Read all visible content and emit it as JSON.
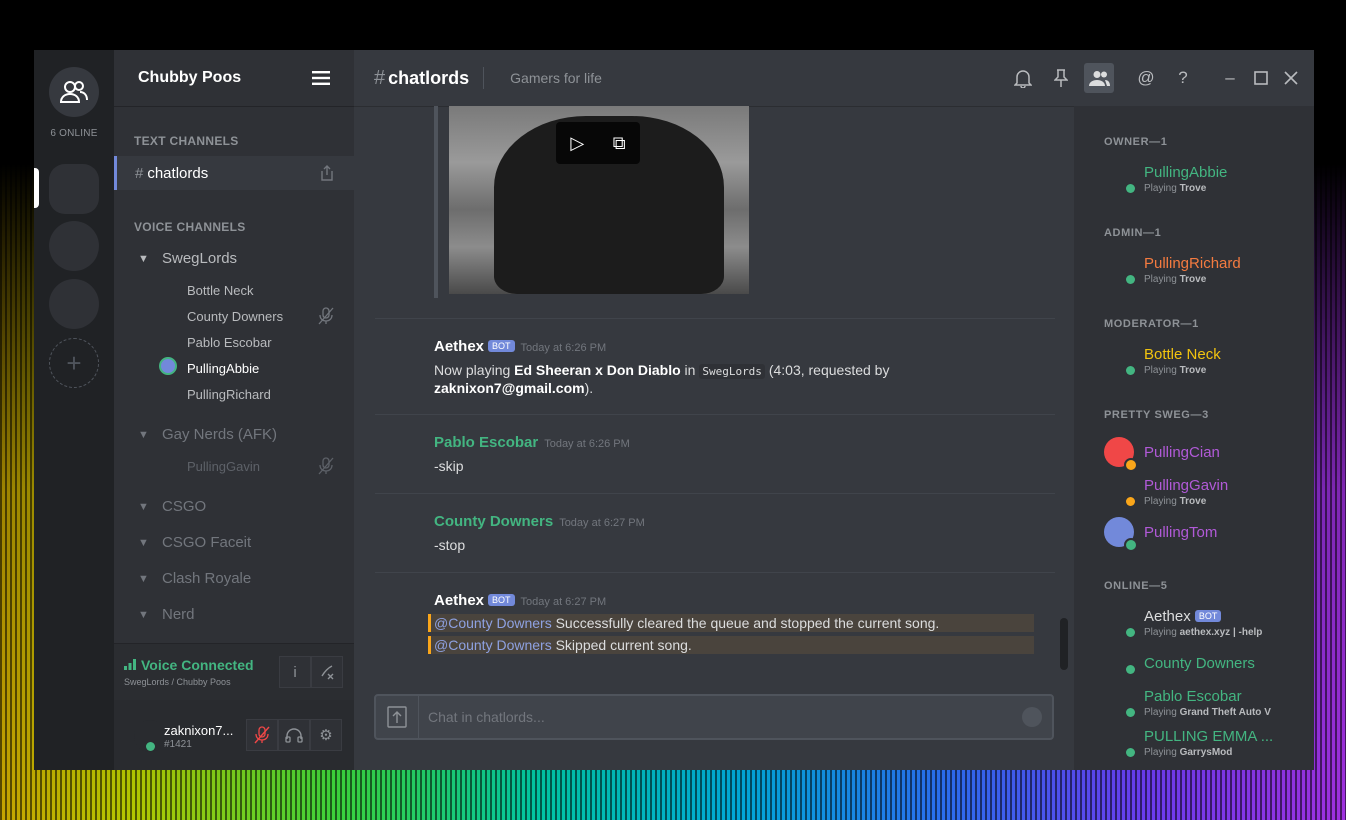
{
  "rail": {
    "online_count": "6 ONLINE"
  },
  "server": {
    "name": "Chubby Poos"
  },
  "sidebar": {
    "text_channels_label": "TEXT CHANNELS",
    "active_channel": "chatlords",
    "voice_channels_label": "VOICE CHANNELS",
    "voice_channels": [
      {
        "name": "SwegLords",
        "users": [
          "Bottle Neck",
          "County Downers",
          "Pablo Escobar",
          "PullingAbbie",
          "PullingRichard"
        ]
      },
      {
        "name": "Gay Nerds (AFK)",
        "users": [
          "PullingGavin"
        ]
      },
      {
        "name": "CSGO"
      },
      {
        "name": "CSGO Faceit"
      },
      {
        "name": "Clash Royale"
      },
      {
        "name": "Nerd"
      }
    ],
    "voice_status": "Voice Connected",
    "voice_sub": "SwegLords / Chubby Poos",
    "user": {
      "name": "zaknixon7...",
      "tag": "#1421"
    }
  },
  "header": {
    "hash": "#",
    "channel": "chatlords",
    "topic": "Gamers for life"
  },
  "messages": [
    {
      "author": "Aethex",
      "badge": "BOT",
      "time": "Today at 6:26 PM",
      "text_1": "Now playing ",
      "song": "Ed Sheeran x Don Diablo",
      "text_2": " in ",
      "channel": "SwegLords",
      "text_3": " (4:03, requested by ",
      "email": "zaknixon7@gmail.com",
      "text_4": ")."
    },
    {
      "author": "Pablo Escobar",
      "time": "Today at 6:26 PM",
      "text": "-skip"
    },
    {
      "author": "County Downers",
      "time": "Today at 6:27 PM",
      "text": "-stop"
    },
    {
      "author": "Aethex",
      "badge": "BOT",
      "time": "Today at 6:27 PM",
      "mention": "@County Downers",
      "line_1": " Successfully cleared the queue and stopped the current song.",
      "line_2": " Skipped current song."
    }
  ],
  "input": {
    "placeholder": "Chat in chatlords..."
  },
  "members": {
    "groups": [
      {
        "label": "OWNER—1",
        "members": [
          {
            "name": "PullingAbbie",
            "playing": "Playing ",
            "game": "Trove",
            "color": "#43b581"
          }
        ]
      },
      {
        "label": "ADMIN—1",
        "members": [
          {
            "name": "PullingRichard",
            "playing": "Playing ",
            "game": "Trove",
            "color": "#f47b40"
          }
        ]
      },
      {
        "label": "MODERATOR—1",
        "members": [
          {
            "name": "Bottle Neck",
            "playing": "Playing ",
            "game": "Trove",
            "color": "#f1c40f"
          }
        ]
      },
      {
        "label": "PRETTY SWEG—3",
        "members": [
          {
            "name": "PullingCian",
            "color": "#b15ad8"
          },
          {
            "name": "PullingGavin",
            "playing": "Playing ",
            "game": "Trove",
            "color": "#b15ad8"
          },
          {
            "name": "PullingTom",
            "color": "#b15ad8"
          }
        ]
      },
      {
        "label": "ONLINE—5",
        "members": [
          {
            "name": "Aethex",
            "badge": "BOT",
            "playing": "Playing ",
            "game": "aethex.xyz | -help",
            "color": "#dcddde"
          },
          {
            "name": "County Downers",
            "color": "#43b581"
          },
          {
            "name": "Pablo Escobar",
            "playing": "Playing ",
            "game": "Grand Theft Auto V",
            "color": "#43b581"
          },
          {
            "name": "PULLING EMMA ...",
            "playing": "Playing ",
            "game": "GarrysMod",
            "color": "#43b581"
          }
        ]
      }
    ]
  },
  "colors": {
    "accent": "#7289da",
    "online": "#43b581",
    "idle": "#faa61a",
    "mention_bar": "#faa61a"
  }
}
